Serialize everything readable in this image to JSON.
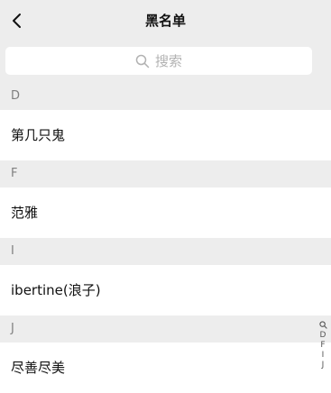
{
  "header": {
    "title": "黑名单",
    "back_icon": "chevron-left-icon"
  },
  "search": {
    "placeholder": "搜索",
    "icon": "search-icon"
  },
  "sections": [
    {
      "letter": "D",
      "contacts": [
        "第几只鬼"
      ]
    },
    {
      "letter": "F",
      "contacts": [
        "范雅"
      ]
    },
    {
      "letter": "I",
      "contacts": [
        "ibertine(浪子)"
      ]
    },
    {
      "letter": "J",
      "contacts": [
        "尽善尽美"
      ]
    }
  ],
  "index_bar": {
    "search_icon": "search-icon",
    "letters": [
      "D",
      "F",
      "I",
      "J"
    ]
  },
  "colors": {
    "background": "#ededed",
    "row_background": "#ffffff",
    "header_text": "#7f7f7f",
    "placeholder": "#b2b2b2"
  }
}
